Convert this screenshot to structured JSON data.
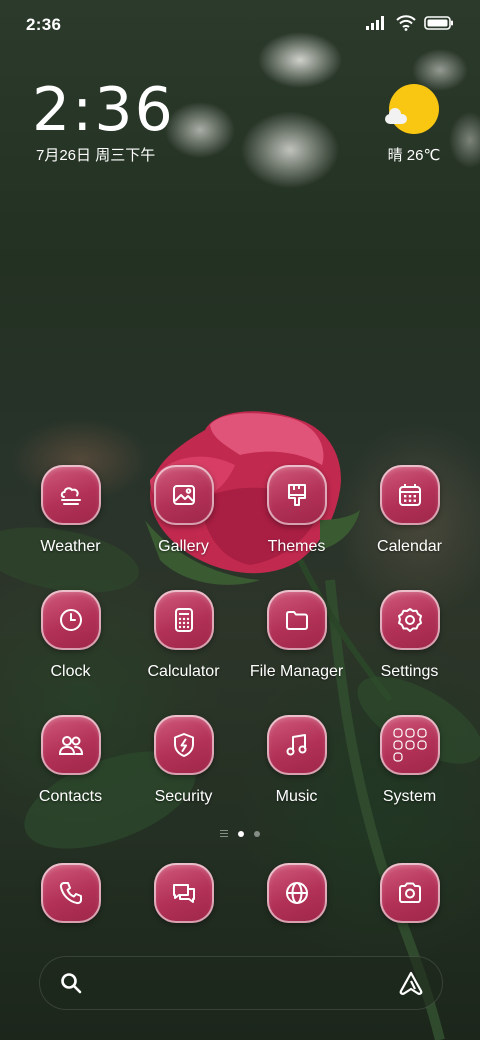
{
  "status_bar": {
    "time": "2:36",
    "icons": [
      "signal-icon",
      "wifi-icon",
      "battery-icon"
    ]
  },
  "clock_widget": {
    "time": "2:36",
    "date": "7月26日 周三下午"
  },
  "weather_widget": {
    "icon": "sunny-partly-cloudy-icon",
    "text": "晴 26℃"
  },
  "apps": [
    {
      "label": "Weather",
      "icon": "weather-icon"
    },
    {
      "label": "Gallery",
      "icon": "gallery-icon"
    },
    {
      "label": "Themes",
      "icon": "themes-brush-icon"
    },
    {
      "label": "Calendar",
      "icon": "calendar-icon"
    },
    {
      "label": "Clock",
      "icon": "clock-icon"
    },
    {
      "label": "Calculator",
      "icon": "calculator-icon"
    },
    {
      "label": "File Manager",
      "icon": "folder-icon"
    },
    {
      "label": "Settings",
      "icon": "gear-icon"
    },
    {
      "label": "Contacts",
      "icon": "contacts-icon"
    },
    {
      "label": "Security",
      "icon": "shield-icon"
    },
    {
      "label": "Music",
      "icon": "music-note-icon"
    },
    {
      "label": "System",
      "icon": "folder-grid-icon"
    }
  ],
  "page_indicator": {
    "pages": 2,
    "active": 1
  },
  "dock": [
    {
      "icon": "phone-icon"
    },
    {
      "icon": "messages-icon"
    },
    {
      "icon": "browser-globe-icon"
    },
    {
      "icon": "camera-icon"
    }
  ],
  "search_bar": {
    "left_icon": "search-icon",
    "right_icon": "assistant-icon"
  },
  "colors": {
    "icon_bg": "#b23157",
    "accent_sun": "#f9c612"
  }
}
